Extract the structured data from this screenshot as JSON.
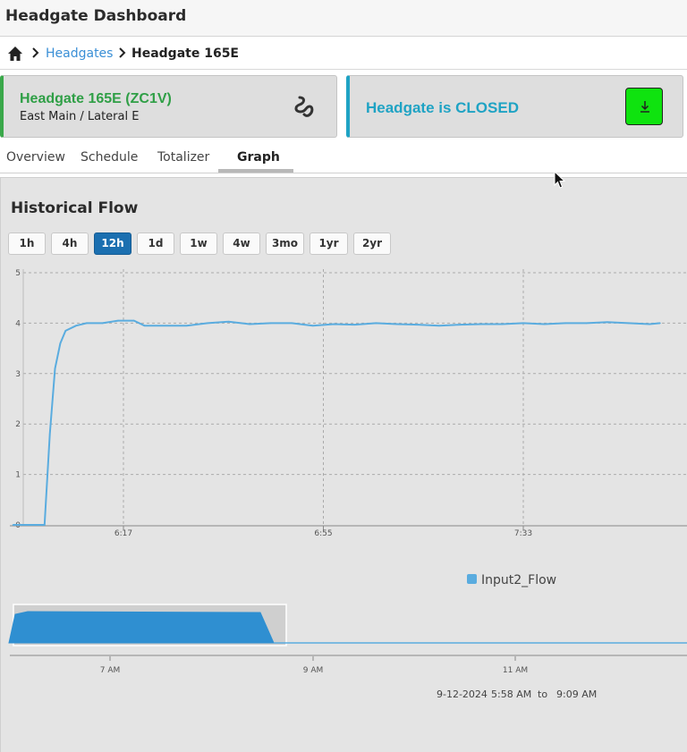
{
  "app": {
    "title": "Headgate Dashboard"
  },
  "breadcrumb": {
    "parent": "Headgates",
    "current": "Headgate 165E"
  },
  "gate_card": {
    "name": "Headgate 165E (ZC1V)",
    "location": "East Main / Lateral E",
    "icon": "wave-icon"
  },
  "status_card": {
    "status": "Headgate is CLOSED",
    "icon": "download-icon"
  },
  "tabs": [
    {
      "label": "Overview"
    },
    {
      "label": "Schedule"
    },
    {
      "label": "Totalizer"
    },
    {
      "label": "Graph",
      "active": true
    }
  ],
  "graph": {
    "title": "Historical Flow",
    "ranges": [
      "1h",
      "4h",
      "12h",
      "1d",
      "1w",
      "4w",
      "3mo",
      "1yr",
      "2yr"
    ],
    "active_range": "12h",
    "navigator": {
      "ticks": [
        "7 AM",
        "9 AM",
        "11 AM"
      ],
      "date": "9-12-2024",
      "from": "5:58 AM",
      "to_label": "to",
      "to": "9:09 AM"
    }
  },
  "chart_data": {
    "type": "line",
    "x_ticks": [
      "6:17",
      "6:55",
      "7:33"
    ],
    "y_ticks": [
      "0",
      "1",
      "2",
      "3",
      "4",
      "5"
    ],
    "ylim": [
      0,
      5
    ],
    "grid": true,
    "legend_position": "bottom",
    "series": [
      {
        "name": "Input2_Flow",
        "color": "#5aacdf",
        "x": [
          "5:56",
          "6:02",
          "6:03",
          "6:04",
          "6:05",
          "6:06",
          "6:08",
          "6:10",
          "6:13",
          "6:16",
          "6:19",
          "6:21",
          "6:25",
          "6:29",
          "6:33",
          "6:37",
          "6:41",
          "6:45",
          "6:49",
          "6:53",
          "6:57",
          "7:01",
          "7:05",
          "7:09",
          "7:13",
          "7:17",
          "7:21",
          "7:25",
          "7:29",
          "7:33",
          "7:37",
          "7:41",
          "7:45",
          "7:49",
          "7:53",
          "7:57",
          "7:59"
        ],
        "values": [
          0,
          0,
          1.8,
          3.1,
          3.6,
          3.85,
          3.95,
          4.0,
          4.0,
          4.05,
          4.05,
          3.95,
          3.95,
          3.95,
          4.0,
          4.03,
          3.98,
          4.0,
          4.0,
          3.95,
          3.98,
          3.97,
          4.0,
          3.98,
          3.97,
          3.95,
          3.97,
          3.98,
          3.98,
          4.0,
          3.98,
          4.0,
          4.0,
          4.02,
          4.0,
          3.98,
          4.0
        ]
      }
    ]
  },
  "colors": {
    "accent": "#1b6fb0",
    "good": "#2f9f46",
    "info": "#1fa3c4",
    "button_green": "#0fe30f",
    "line": "#5aacdf"
  }
}
